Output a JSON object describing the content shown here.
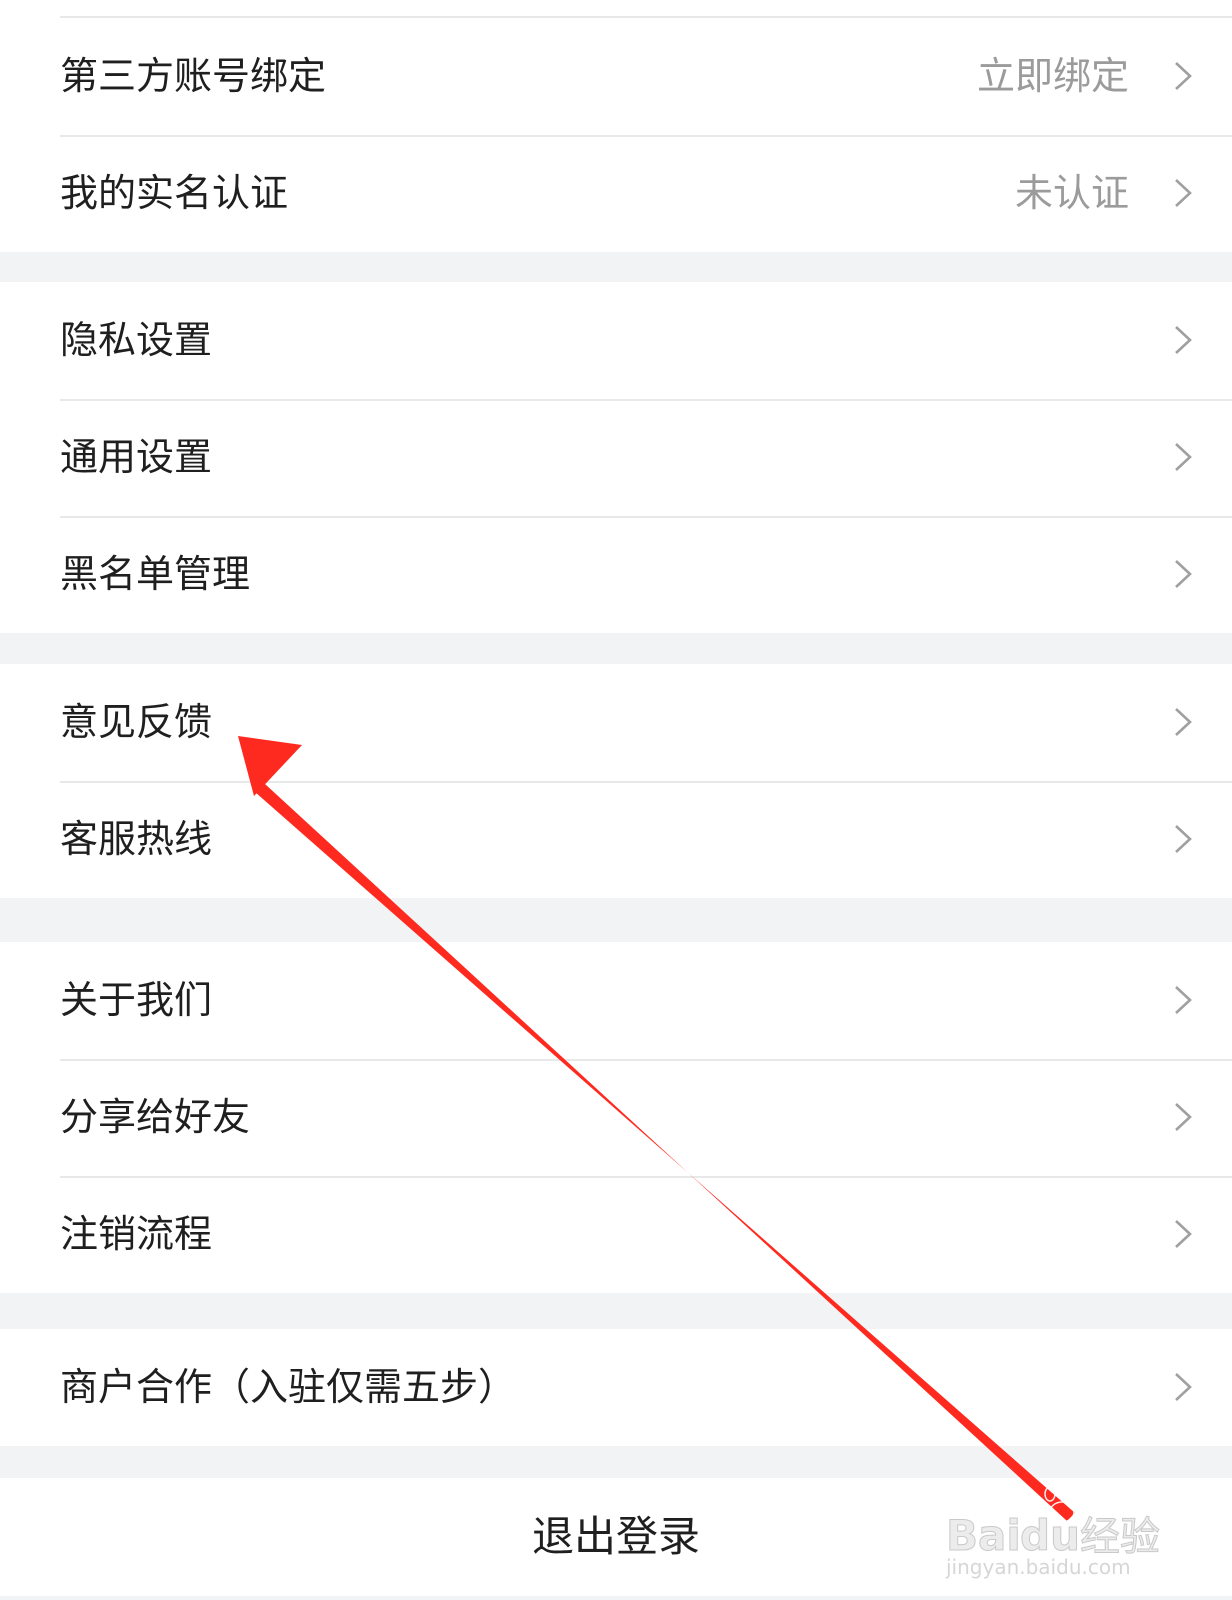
{
  "groups": [
    {
      "items": [
        {
          "label": "第三方账号绑定",
          "value": "立即绑定"
        },
        {
          "label": "我的实名认证",
          "value": "未认证"
        }
      ]
    },
    {
      "items": [
        {
          "label": "隐私设置"
        },
        {
          "label": "通用设置"
        },
        {
          "label": "黑名单管理"
        }
      ]
    },
    {
      "items": [
        {
          "label": "意见反馈"
        },
        {
          "label": "客服热线"
        }
      ]
    },
    {
      "items": [
        {
          "label": "关于我们"
        },
        {
          "label": "分享给好友"
        },
        {
          "label": "注销流程"
        }
      ]
    },
    {
      "items": [
        {
          "label": "商户合作（入驻仅需五步）"
        }
      ]
    }
  ],
  "logout": {
    "label": "退出登录"
  },
  "annotation": {
    "color": "#ff2a1f",
    "icon": "arrow-pointer-icon"
  },
  "watermark": {
    "brand": "Baidu经验",
    "domain": "jingyan.baidu.com",
    "icon": "paw-logo-icon"
  }
}
